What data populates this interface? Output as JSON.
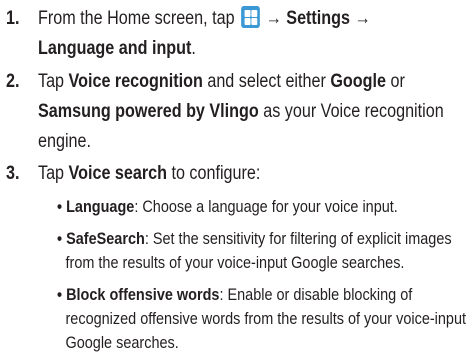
{
  "steps": [
    {
      "number": "1.",
      "line1_pre": "From the Home screen, tap",
      "arrow1": "→",
      "line1_bold": "Settings",
      "arrow2": "→",
      "line2_bold": "Language and input",
      "line2_end": "."
    },
    {
      "number": "2.",
      "tap": "Tap",
      "bold1": "Voice recognition",
      "mid": "and select either",
      "bold2": "Google",
      "or": "or",
      "bold3": "Samsung powered by Vlingo",
      "rest": "as your Voice recognition",
      "line3": "engine."
    },
    {
      "number": "3.",
      "tap": "Tap",
      "bold": "Voice search",
      "rest": "to configure:"
    }
  ],
  "bullets": [
    {
      "title": "Language",
      "lines": [
        ": Choose a language for your voice input."
      ]
    },
    {
      "title": "SafeSearch",
      "lines": [
        ": Set the sensitivity for filtering of explicit images",
        "from the results of your voice-input Google searches."
      ]
    },
    {
      "title": "Block offensive words",
      "lines": [
        ": Enable or disable blocking of",
        "recognized offensive words from the results of your voice-input",
        "Google searches."
      ]
    }
  ],
  "icon": "apps-grid-icon",
  "colors": {
    "icon": "#3a98d5",
    "text": "#231f20"
  }
}
